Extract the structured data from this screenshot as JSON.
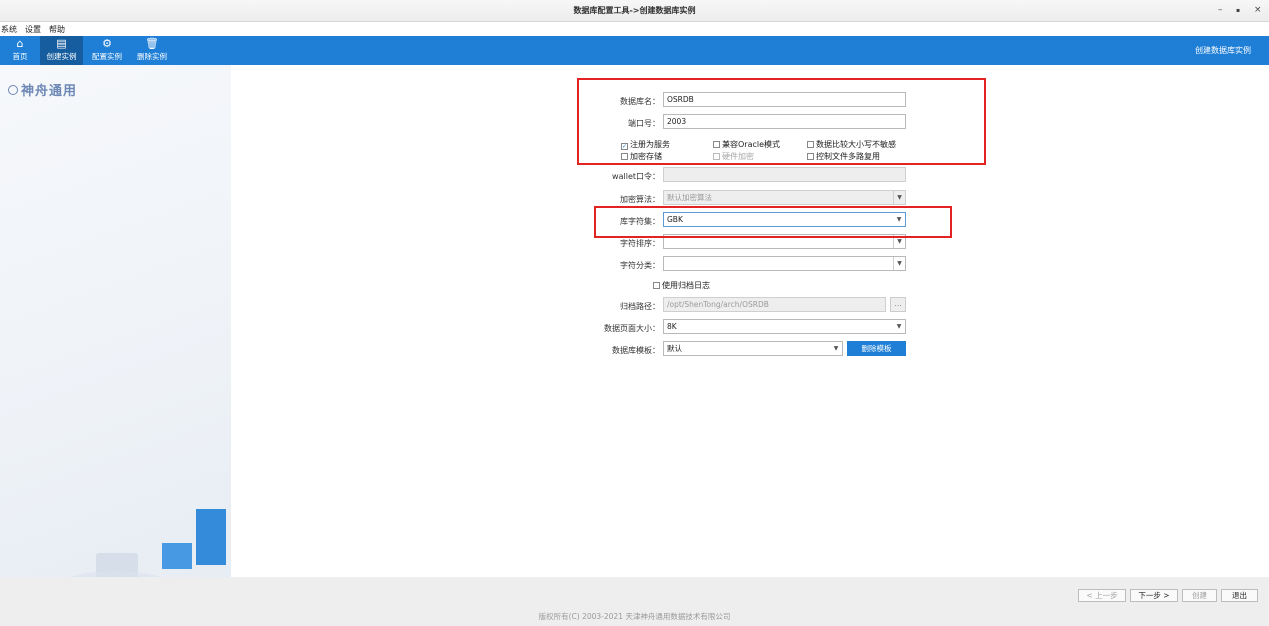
{
  "window": {
    "title": "数据库配置工具->创建数据库实例",
    "minimize": "–",
    "maximize": "▪",
    "close": "×"
  },
  "menu": [
    "系统",
    "设置",
    "帮助"
  ],
  "toolbar": {
    "items": [
      {
        "label": "首页",
        "icon": "home-icon",
        "glyph": "⌂"
      },
      {
        "label": "创建实例",
        "icon": "create-instance-icon",
        "glyph": "▤"
      },
      {
        "label": "配置实例",
        "icon": "config-instance-icon",
        "glyph": "⚙"
      },
      {
        "label": "删除实例",
        "icon": "delete-instance-icon",
        "glyph": "🗑"
      }
    ],
    "active": "创建实例",
    "right_title": "创建数据库实例",
    "color": "#1f7fd6"
  },
  "sidebar": {
    "logo_text": "神舟通用"
  },
  "form": {
    "db_name": {
      "label": "数据库名：",
      "value": "OSRDB"
    },
    "port": {
      "label": "端口号：",
      "value": "2003"
    },
    "checkboxes": {
      "register_service": {
        "label": "注册为服务",
        "checked": true
      },
      "oracle_compat": {
        "label": "兼容Oracle模式",
        "checked": false
      },
      "case_insensitive": {
        "label": "数据比较大小写不敏感",
        "checked": false
      },
      "encrypt_storage": {
        "label": "加密存储",
        "checked": false
      },
      "hardware_encrypt": {
        "label": "硬件加密",
        "checked": false
      },
      "multi_control_file": {
        "label": "控制文件多路复用",
        "checked": false
      }
    },
    "wallet": {
      "label": "wallet口令：",
      "value": ""
    },
    "encrypt_algo": {
      "label": "加密算法：",
      "value": "默认加密算法"
    },
    "charset": {
      "label": "库字符集：",
      "value": "GBK"
    },
    "collation": {
      "label": "字符排序：",
      "value": ""
    },
    "char_class": {
      "label": "字符分类：",
      "value": ""
    },
    "archive_log": {
      "label": "使用归档日志",
      "checked": false
    },
    "archive_path": {
      "label": "归档路径：",
      "value": "/opt/ShenTong/arch/OSRDB",
      "browse": "..."
    },
    "page_size": {
      "label": "数据页面大小：",
      "value": "8K"
    },
    "template": {
      "label": "数据库模板：",
      "value": "默认",
      "delete_label": "删除模板"
    }
  },
  "nav": {
    "prev": "< 上一步",
    "next": "下一步 >",
    "create": "创建",
    "exit": "退出"
  },
  "footer": {
    "copyright": "版权所有(C) 2003-2021 天津神舟通用数据技术有限公司"
  },
  "colors": {
    "accent": "#1f7fd6",
    "highlight": "#e32222"
  }
}
